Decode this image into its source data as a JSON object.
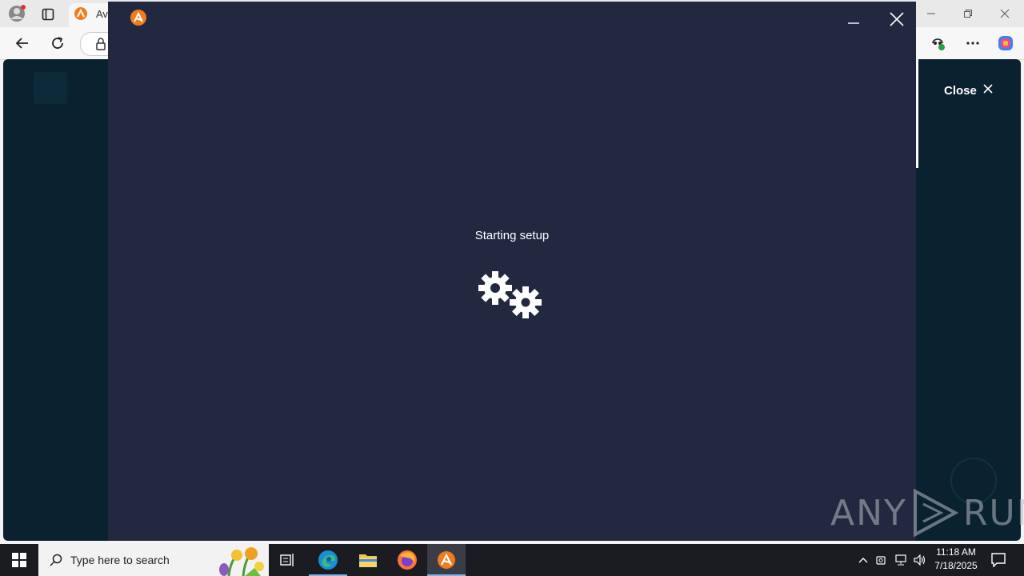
{
  "browser": {
    "tab_title": "Ava",
    "page_close_label": "Close"
  },
  "installer": {
    "status_text": "Starting setup",
    "colors": {
      "background": "#212840",
      "brand": "#f07c1e"
    }
  },
  "taskbar": {
    "search_placeholder": "Type here to search",
    "clock_time": "11:18 AM",
    "clock_date": "7/18/2025",
    "apps": [
      "task-view",
      "edge",
      "file-explorer",
      "firefox",
      "avast-installer"
    ]
  },
  "watermark": {
    "left_text": "ANY",
    "right_text": "RUN"
  }
}
